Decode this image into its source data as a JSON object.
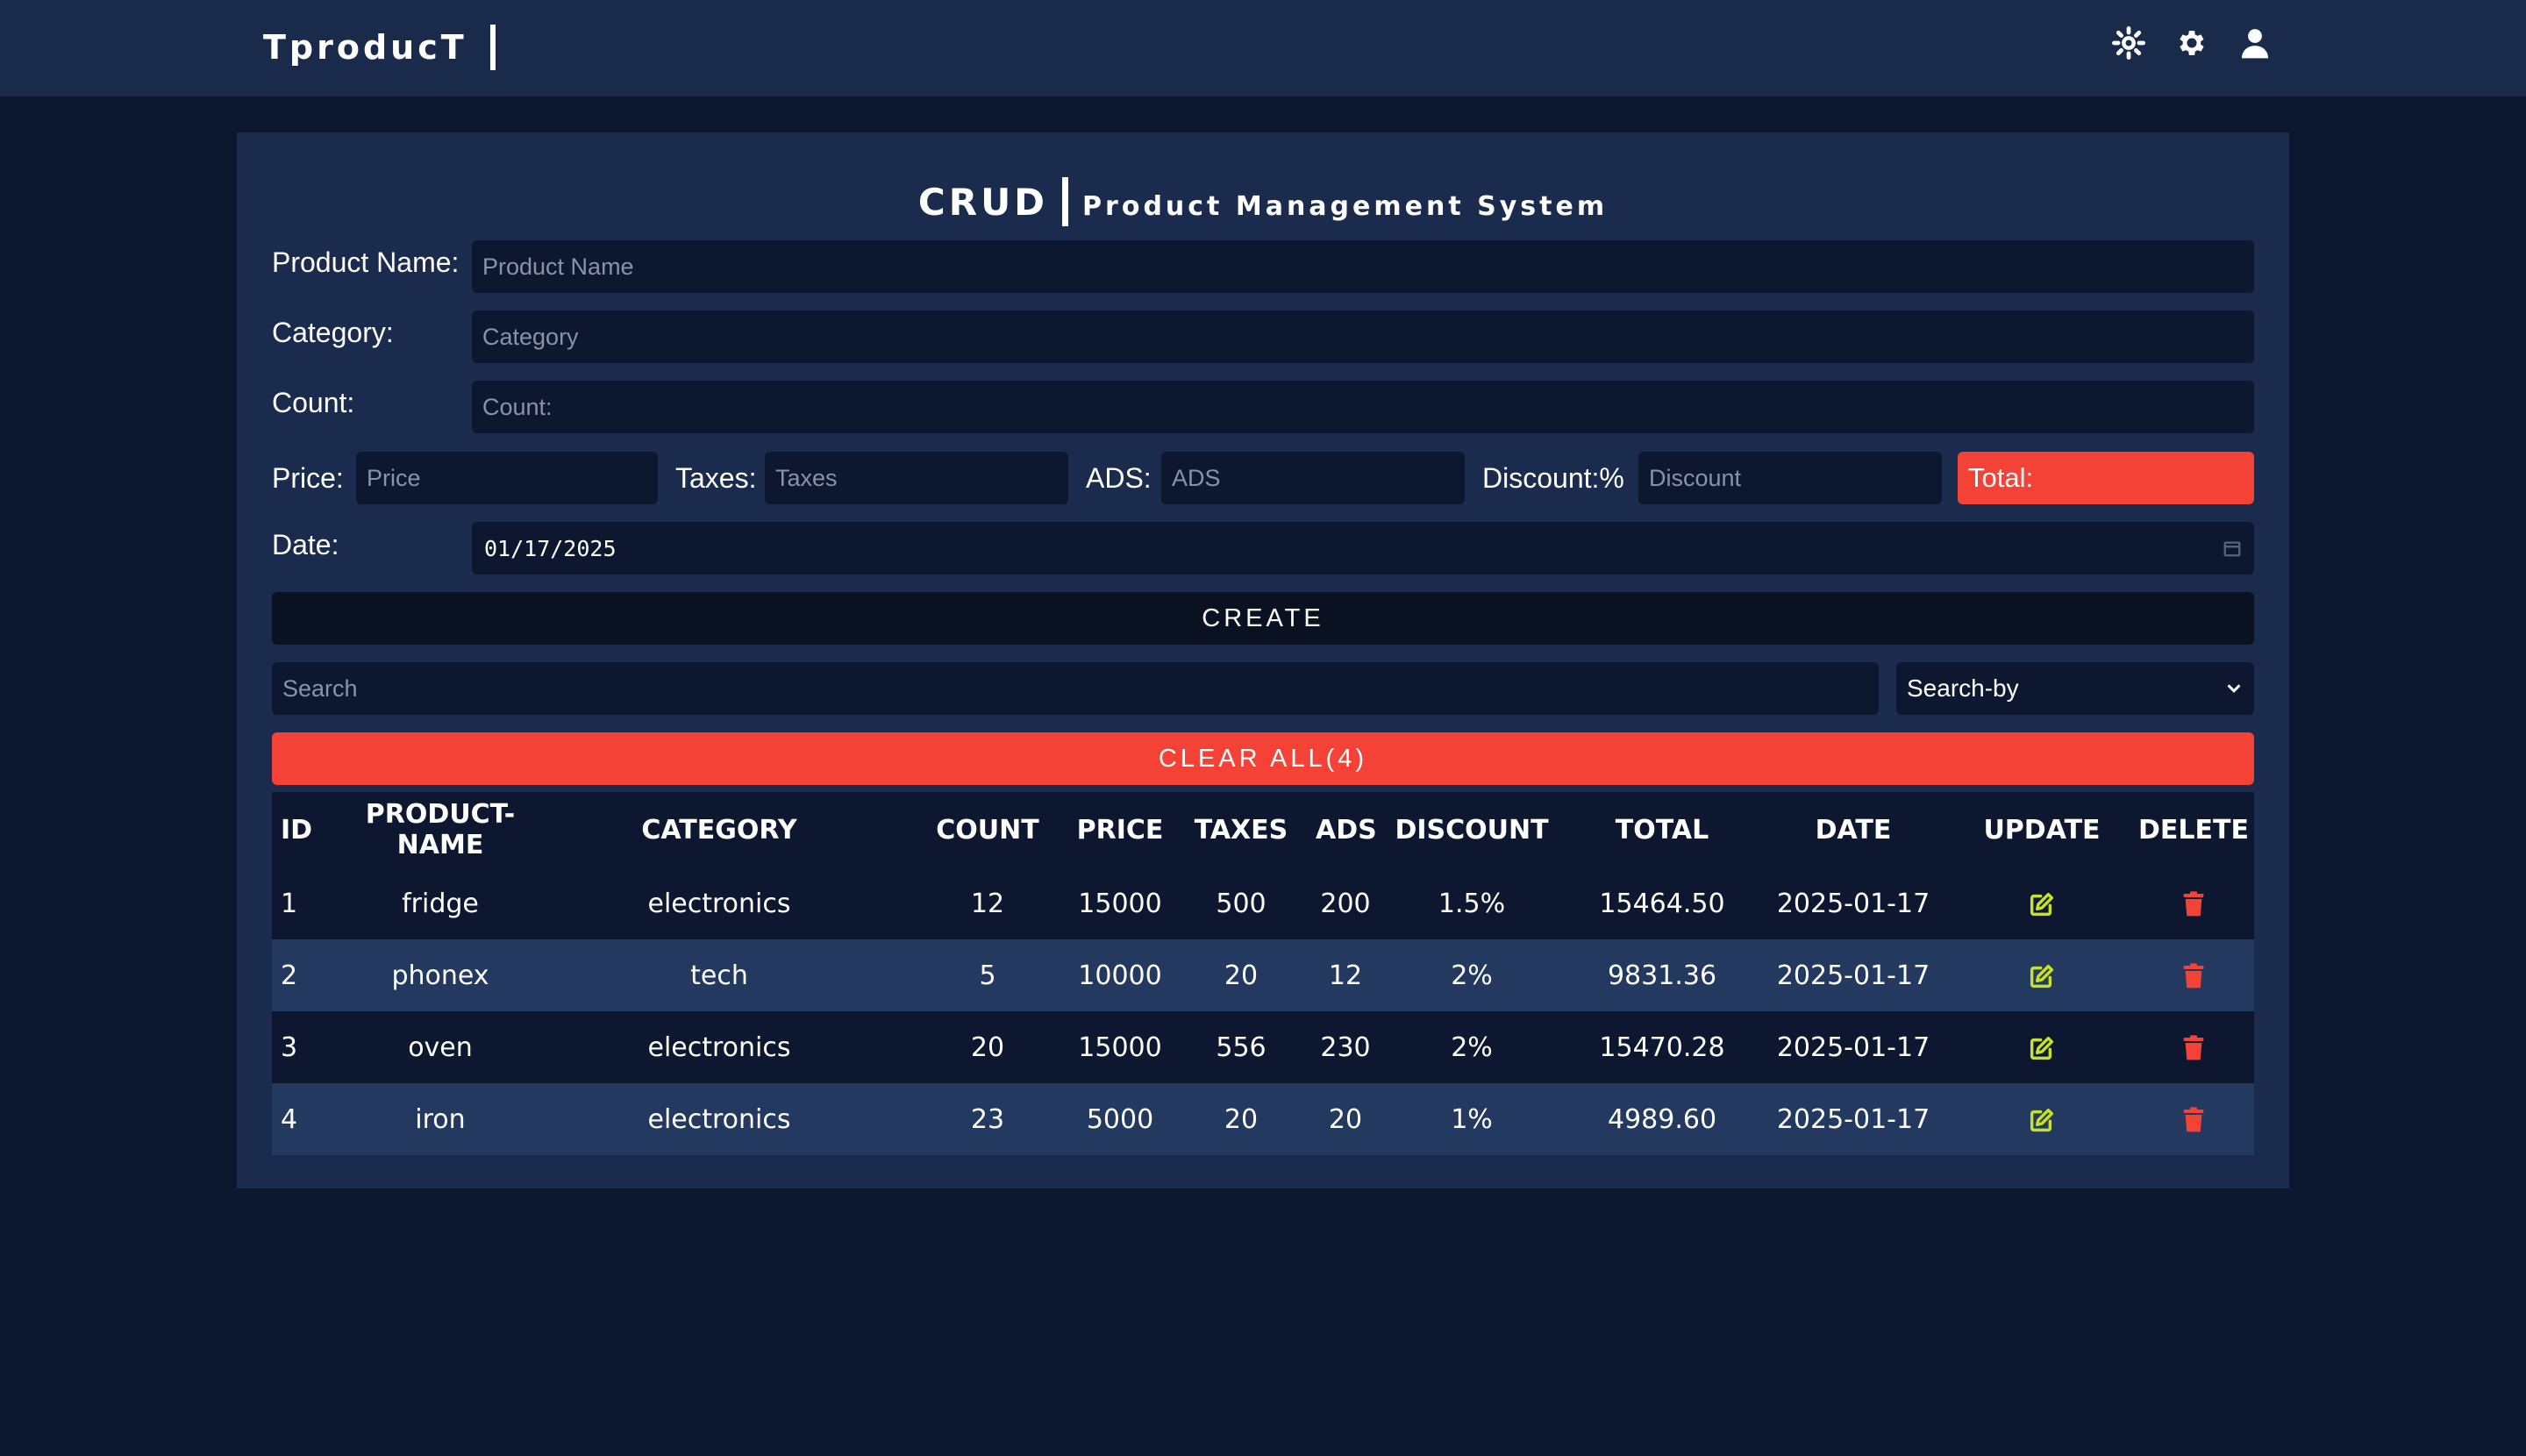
{
  "app": {
    "brand": "TproducT"
  },
  "nav": {
    "icons": [
      "brightness-icon",
      "settings-icon",
      "user-icon"
    ]
  },
  "header": {
    "title": "CRUD",
    "subtitle": "Product Management System"
  },
  "form": {
    "product_name": {
      "label": "Product Name:",
      "placeholder": "Product Name",
      "value": ""
    },
    "category": {
      "label": "Category:",
      "placeholder": "Category",
      "value": ""
    },
    "count": {
      "label": "Count:",
      "placeholder": "Count:",
      "value": ""
    },
    "price": {
      "label": "Price:",
      "placeholder": "Price",
      "value": ""
    },
    "taxes": {
      "label": "Taxes:",
      "placeholder": "Taxes",
      "value": ""
    },
    "ads": {
      "label": "ADS:",
      "placeholder": "ADS",
      "value": ""
    },
    "discount": {
      "label": "Discount:%",
      "placeholder": "Discount",
      "value": ""
    },
    "total": {
      "label": "Total:"
    },
    "date": {
      "label": "Date:",
      "value": "01/17/2025"
    },
    "create_label": "CREATE"
  },
  "search": {
    "placeholder": "Search",
    "value": "",
    "search_by": "Search-by"
  },
  "clear_all_label": "CLEAR ALL(4)",
  "table": {
    "headers": [
      "ID",
      "PRODUCT-NAME",
      "CATEGORY",
      "COUNT",
      "PRICE",
      "TAXES",
      "ADS",
      "DISCOUNT",
      "TOTAL",
      "DATE",
      "UPDATE",
      "DELETE"
    ],
    "rows": [
      {
        "id": "1",
        "name": "fridge",
        "category": "electronics",
        "count": "12",
        "price": "15000",
        "taxes": "500",
        "ads": "200",
        "discount": "1.5%",
        "total": "15464.50",
        "date": "2025-01-17"
      },
      {
        "id": "2",
        "name": "phonex",
        "category": "tech",
        "count": "5",
        "price": "10000",
        "taxes": "20",
        "ads": "12",
        "discount": "2%",
        "total": "9831.36",
        "date": "2025-01-17"
      },
      {
        "id": "3",
        "name": "oven",
        "category": "electronics",
        "count": "20",
        "price": "15000",
        "taxes": "556",
        "ads": "230",
        "discount": "2%",
        "total": "15470.28",
        "date": "2025-01-17"
      },
      {
        "id": "4",
        "name": "iron",
        "category": "electronics",
        "count": "23",
        "price": "5000",
        "taxes": "20",
        "ads": "20",
        "discount": "1%",
        "total": "4989.60",
        "date": "2025-01-17"
      }
    ]
  },
  "colors": {
    "background": "#0d1830",
    "navbar": "#1a2a4b",
    "panel": "#1b2b4d",
    "row_alt": "#23395f",
    "accent_red": "#f44336",
    "edit_icon": "#c6e02c",
    "delete_icon": "#f44336"
  }
}
